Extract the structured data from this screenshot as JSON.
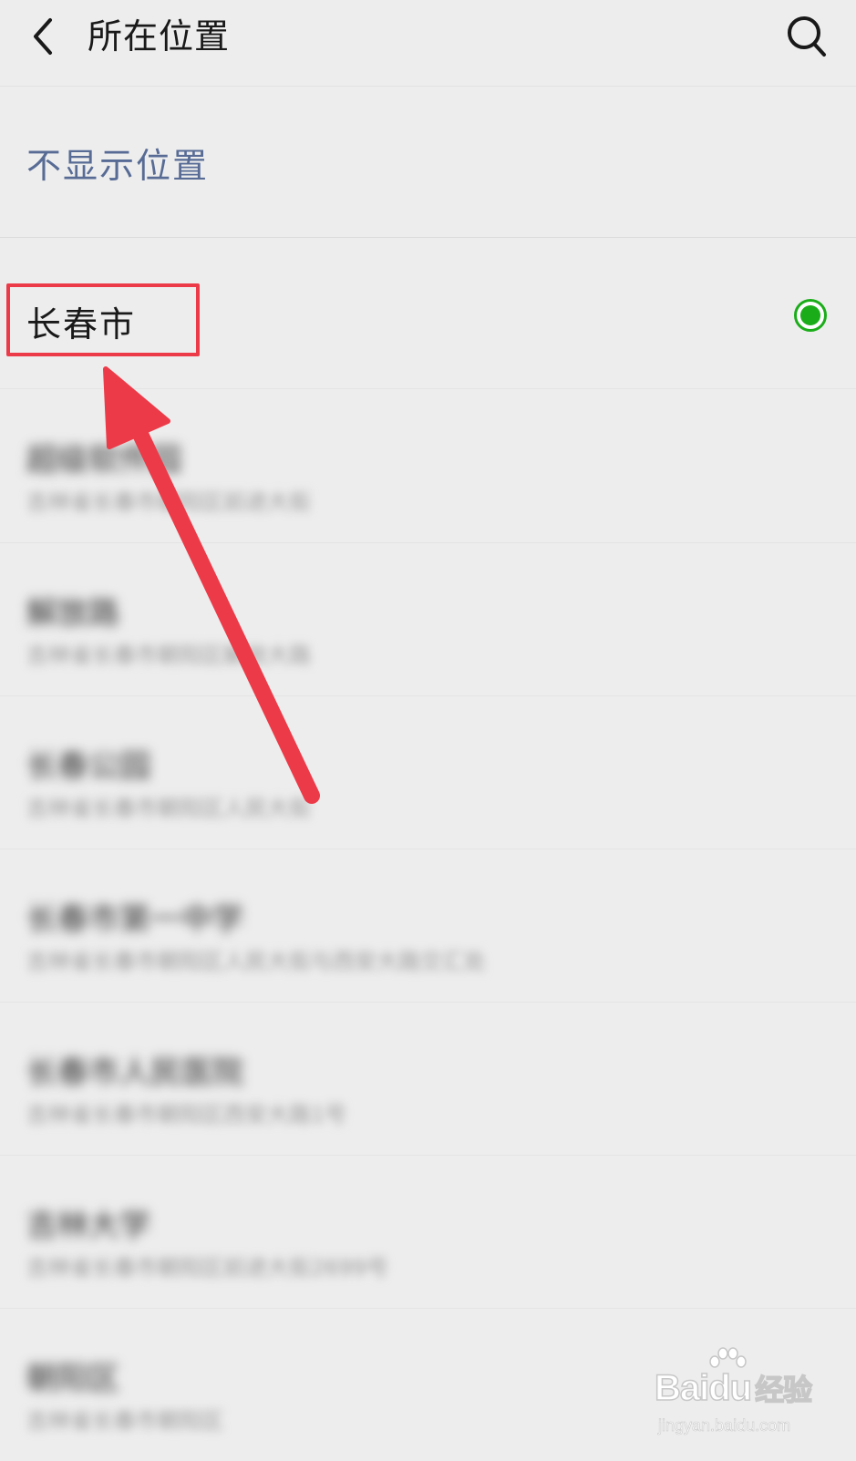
{
  "header": {
    "title": "所在位置",
    "back_icon": "chevron-left-icon",
    "search_icon": "search-icon"
  },
  "options": {
    "hide_location_label": "不显示位置",
    "current_city_label": "长春市",
    "current_city_selected": true
  },
  "poi_list": [
    {
      "name": "超级软件园",
      "address": "吉林省长春市朝阳区前进大街"
    },
    {
      "name": "解放路",
      "address": "吉林省长春市朝阳区解放大路"
    },
    {
      "name": "长春公园",
      "address": "吉林省长春市朝阳区人民大街"
    },
    {
      "name": "长春市第一中学",
      "address": "吉林省长春市朝阳区人民大街与西安大路交汇处"
    },
    {
      "name": "长春市人民医院",
      "address": "吉林省长春市朝阳区西安大路1号"
    },
    {
      "name": "吉林大学",
      "address": "吉林省长春市朝阳区前进大街2699号"
    },
    {
      "name": "朝阳区",
      "address": "吉林省长春市朝阳区"
    }
  ],
  "colors": {
    "background": "#ededed",
    "link_blue": "#576b95",
    "selected_green": "#1aad19",
    "annotation_red": "#ec3a48"
  },
  "watermark": {
    "logo_text": "Baidu",
    "logo_cn": "经验",
    "url": "jingyan.baidu.com"
  }
}
